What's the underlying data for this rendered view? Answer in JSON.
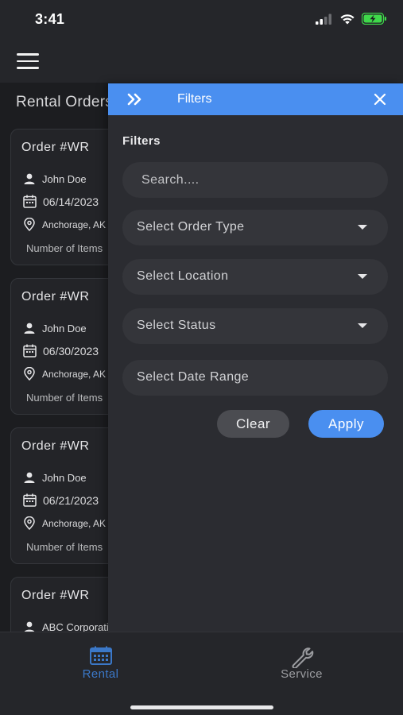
{
  "status_bar": {
    "time": "3:41",
    "icons": [
      "cellular-signal-icon",
      "wifi-icon",
      "battery-charging-icon"
    ]
  },
  "header": {
    "menu_icon": "hamburger-menu-icon"
  },
  "page": {
    "title": "Rental Orders"
  },
  "orders": [
    {
      "title": "Order  #WR",
      "customer": "John Doe",
      "date": "06/14/2023",
      "location": "Anchorage, AK",
      "items": "Number of Items"
    },
    {
      "title": "Order  #WR",
      "customer": "John Doe",
      "date": "06/30/2023",
      "location": "Anchorage, AK",
      "items": "Number of Items"
    },
    {
      "title": "Order  #WR",
      "customer": "John Doe",
      "date": "06/21/2023",
      "location": "Anchorage, AK",
      "items": "Number of Items"
    },
    {
      "title": "Order  #WR",
      "customer": "ABC Corporation",
      "date": "",
      "location": "",
      "items": ""
    }
  ],
  "filter_panel": {
    "title": "Filters",
    "section_label": "Filters",
    "search": {
      "placeholder": "Search....",
      "value": ""
    },
    "order_type": {
      "label": "Select Order Type"
    },
    "location": {
      "label": "Select Location"
    },
    "status": {
      "label": "Select Status"
    },
    "date_range": {
      "label": "Select Date Range"
    },
    "clear_label": "Clear",
    "apply_label": "Apply"
  },
  "tabs": [
    {
      "label": "Rental",
      "icon": "calendar-icon",
      "active": true
    },
    {
      "label": "Service",
      "icon": "wrench-icon",
      "active": false
    }
  ],
  "colors": {
    "accent": "#4a8ff0",
    "active_tab": "#3b78c8",
    "background": "#1c1d20",
    "panel": "#2b2c31"
  }
}
